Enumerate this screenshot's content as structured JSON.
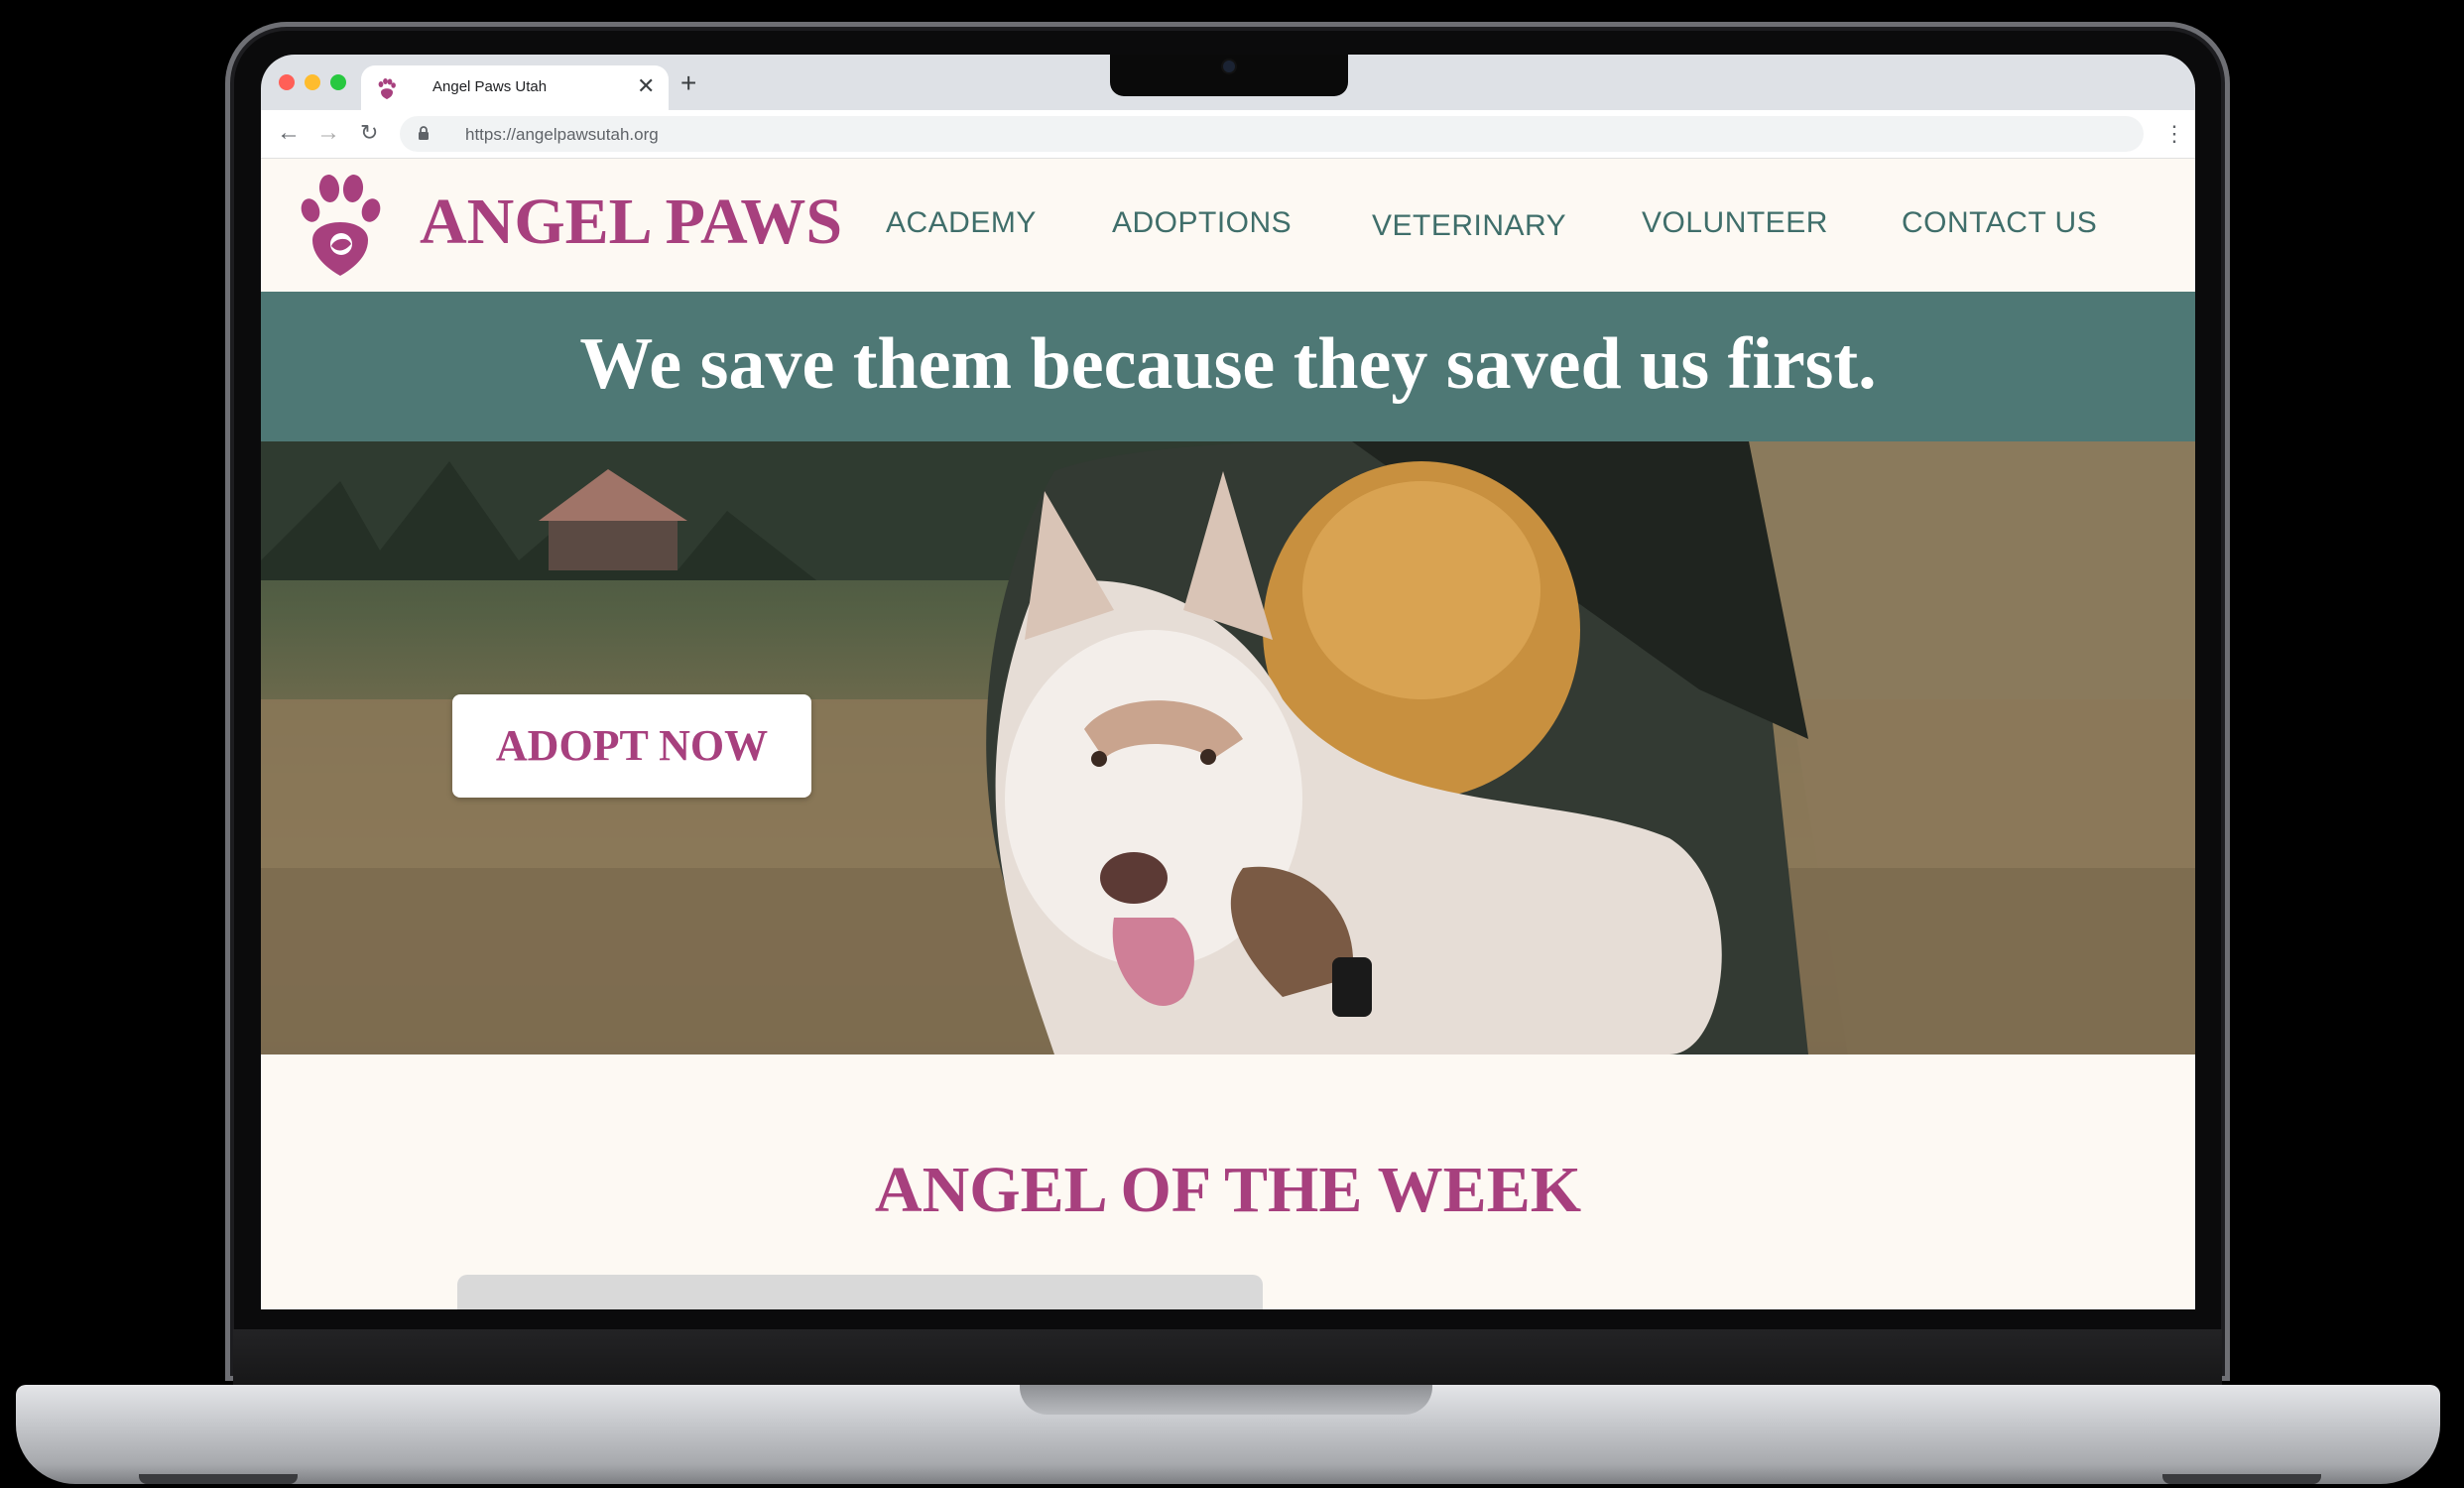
{
  "browser": {
    "tab_title": "Angel Paws Utah",
    "url": "https://angelpawsutah.org",
    "new_tab_symbol": "+",
    "close_symbol": "✕",
    "back_symbol": "←",
    "forward_symbol": "→",
    "reload_symbol": "↻",
    "menu_symbol": "⋮"
  },
  "site": {
    "brand": "ANGEL PAWS",
    "nav": [
      "ACADEMY",
      "ADOPTIONS",
      "VETERINARY",
      "VOLUNTEER",
      "CONTACT US"
    ],
    "tagline": "We save them because they saved us first.",
    "cta_label": "ADOPT NOW",
    "section_heading": "ANGEL OF THE WEEK"
  },
  "colors": {
    "brand_magenta": "#a7407e",
    "teal_banner": "#4e7875",
    "nav_teal": "#3f6e6a",
    "page_background": "#fdf9f3"
  },
  "icons": {
    "logo": "paw-logo-icon",
    "favicon": "paw-favicon-icon",
    "lock": "lock-icon"
  }
}
